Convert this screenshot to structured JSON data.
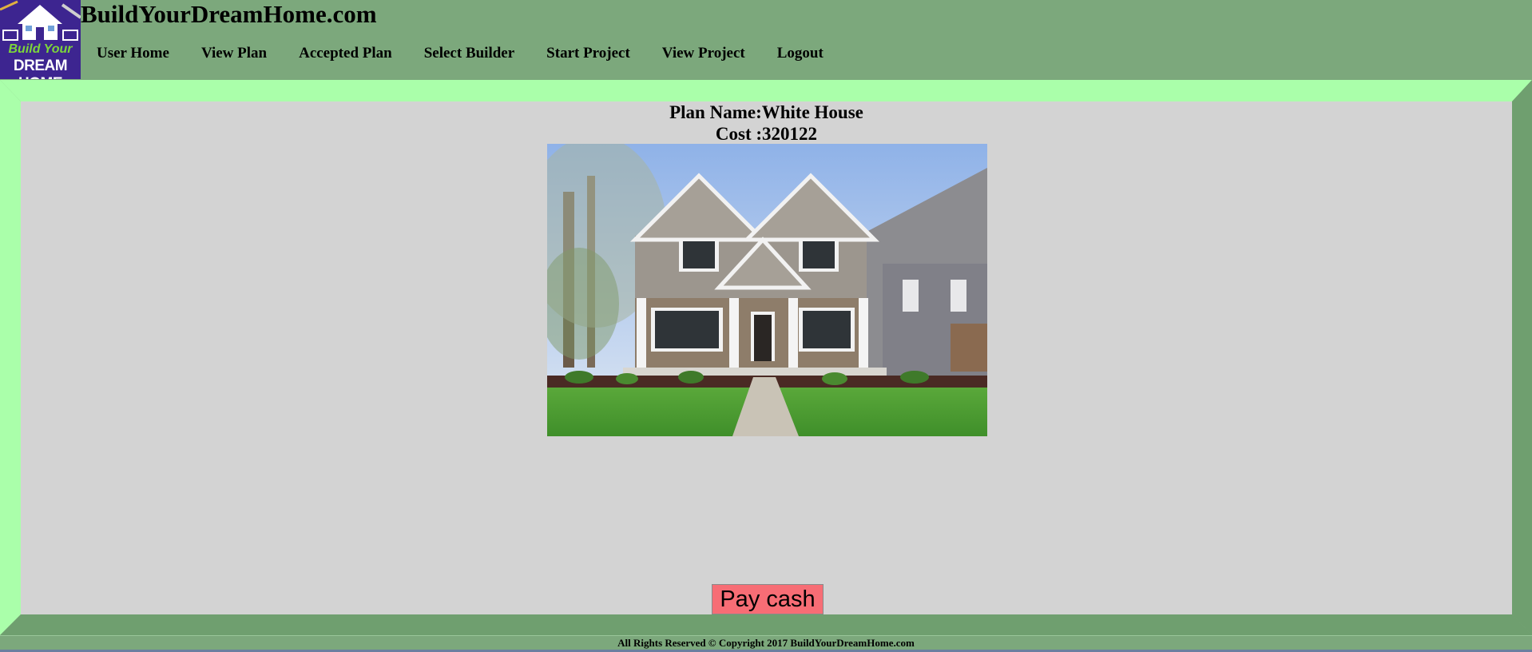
{
  "site": {
    "title": "BuildYourDreamHome.com",
    "logo_line1": "Build Your",
    "logo_line2": "DREAM HOME"
  },
  "nav": {
    "items": [
      {
        "label": "User Home"
      },
      {
        "label": "View Plan"
      },
      {
        "label": "Accepted Plan"
      },
      {
        "label": "Select Builder"
      },
      {
        "label": "Start Project"
      },
      {
        "label": "View Project"
      },
      {
        "label": "Logout"
      }
    ]
  },
  "plan": {
    "name_text": "Plan Name:White House",
    "cost_text": "Cost :320122",
    "image_icon": "house-photo"
  },
  "actions": {
    "pay_label": "Pay cash"
  },
  "footer": {
    "text": "All Rights Reserved © Copyright 2017 BuildYourDreamHome.com"
  },
  "colors": {
    "header_bg": "#7ca87c",
    "frame_light": "#aaffaa",
    "content_bg": "#d3d3d3",
    "pay_button": "#f76d75"
  }
}
